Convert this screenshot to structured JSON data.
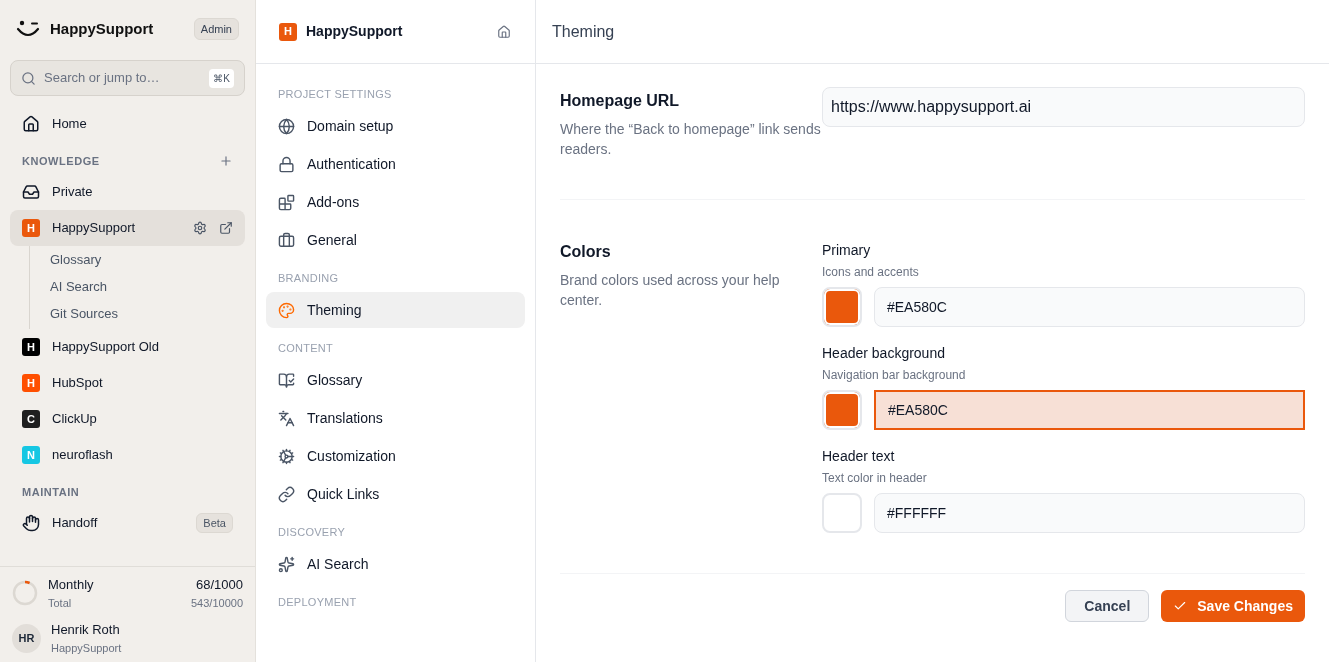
{
  "sidebar": {
    "brand": "HappySupport",
    "role_badge": "Admin",
    "search": {
      "placeholder": "Search or jump to…",
      "shortcut": "⌘K"
    },
    "home": "Home",
    "sections": [
      {
        "title": "KNOWLEDGE",
        "add": true,
        "items": [
          {
            "kind": "icon",
            "label": "Private",
            "selected": false
          },
          {
            "kind": "project",
            "label": "HappySupport",
            "letter": "H",
            "color": "#ea580c",
            "selected": true,
            "actions": true,
            "children": [
              {
                "label": "Glossary"
              },
              {
                "label": "AI Search"
              },
              {
                "label": "Git Sources"
              }
            ]
          },
          {
            "kind": "project",
            "label": "HappySupport Old",
            "letter": "H",
            "color": "#000000",
            "selected": false
          },
          {
            "kind": "project",
            "label": "HubSpot",
            "letter": "H",
            "color": "#ff4f00",
            "selected": false
          },
          {
            "kind": "project",
            "label": "ClickUp",
            "letter": "C",
            "color": "#1f1f1f",
            "selected": false
          },
          {
            "kind": "project",
            "label": "neuroflash",
            "letter": "N",
            "color": "#16c7e3",
            "selected": false
          }
        ]
      },
      {
        "title": "MAINTAIN",
        "add": false,
        "items": [
          {
            "kind": "icon",
            "label": "Handoff",
            "badge": "Beta",
            "selected": false
          }
        ]
      }
    ],
    "usage": {
      "level": 0.068,
      "monthly_label": "Monthly",
      "monthly_value": "68/1000",
      "total_label": "Total",
      "total_value": "543/10000"
    },
    "user": {
      "initials": "HR",
      "name": "Henrik Roth",
      "org": "HappySupport"
    }
  },
  "settings_nav": {
    "project": {
      "letter": "H",
      "name": "HappySupport",
      "color": "#ea580c"
    },
    "sections": [
      {
        "title": "PROJECT SETTINGS",
        "items": [
          {
            "label": "Domain setup",
            "selected": false
          },
          {
            "label": "Authentication",
            "selected": false
          },
          {
            "label": "Add-ons",
            "selected": false
          },
          {
            "label": "General",
            "selected": false
          }
        ]
      },
      {
        "title": "BRANDING",
        "items": [
          {
            "label": "Theming",
            "selected": true
          }
        ]
      },
      {
        "title": "CONTENT",
        "items": [
          {
            "label": "Glossary",
            "selected": false
          },
          {
            "label": "Translations",
            "selected": false
          },
          {
            "label": "Customization",
            "selected": false
          },
          {
            "label": "Quick Links",
            "selected": false
          }
        ]
      },
      {
        "title": "DISCOVERY",
        "items": [
          {
            "label": "AI Search",
            "selected": false
          }
        ]
      },
      {
        "title": "DEPLOYMENT"
      }
    ]
  },
  "page": {
    "title": "Theming",
    "homepage": {
      "title": "Homepage URL",
      "description": "Where the “Back to homepage” link sends readers.",
      "value": "https://www.happysupport.ai"
    },
    "colors": {
      "title": "Colors",
      "description": "Brand colors used across your help center.",
      "fields": [
        {
          "label": "Primary",
          "hint": "Icons and accents",
          "value": "#EA580C",
          "color": "#ea580c",
          "focused": false
        },
        {
          "label": "Header background",
          "hint": "Navigation bar background",
          "value": "#EA580C",
          "color": "#ea580c",
          "focused": true
        },
        {
          "label": "Header text",
          "hint": "Text color in header",
          "value": "#FFFFFF",
          "color": "#ffffff",
          "focused": false
        }
      ]
    },
    "buttons": {
      "cancel": "Cancel",
      "save": "Save Changes"
    }
  }
}
